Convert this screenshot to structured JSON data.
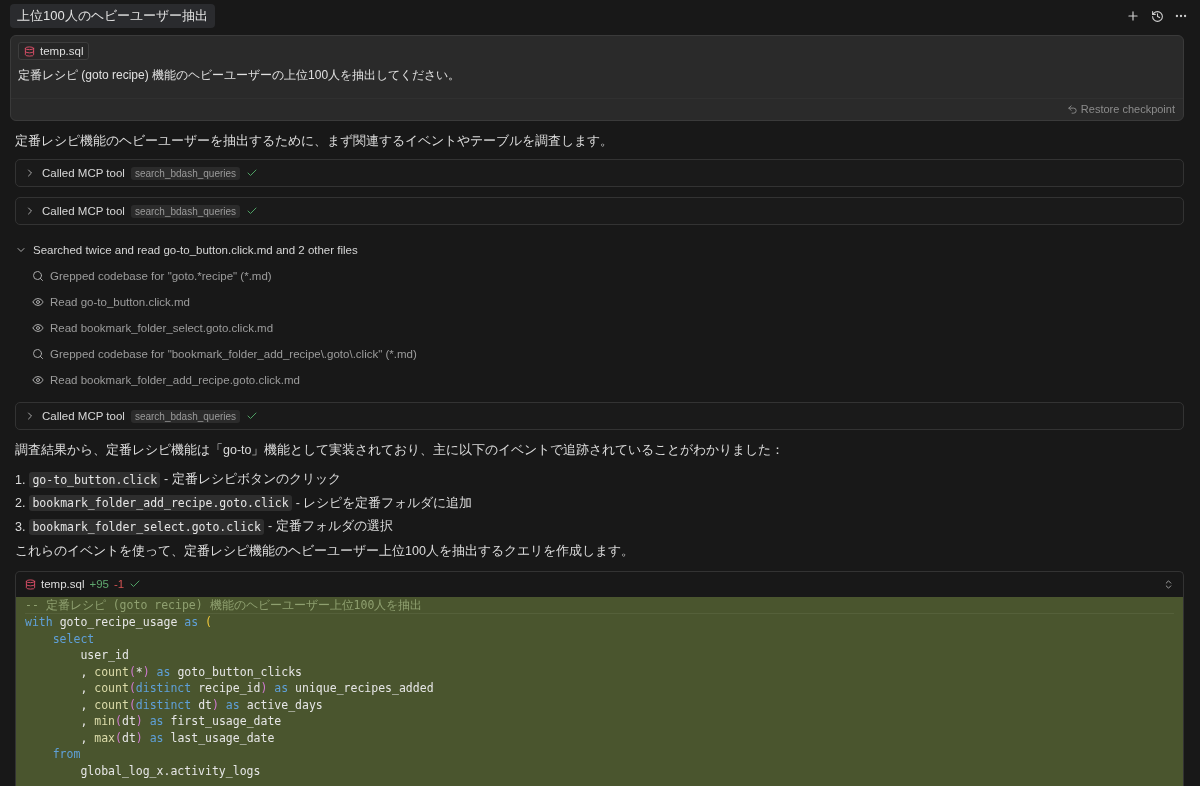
{
  "title": "上位100人のヘビーユーザー抽出",
  "user_message": {
    "attachment": "temp.sql",
    "text": "定番レシピ (goto recipe) 機能のヘビーユーザーの上位100人を抽出してください。",
    "restore": "Restore checkpoint"
  },
  "steps": [
    {
      "kind": "text",
      "text": "定番レシピ機能のヘビーユーザーを抽出するために、まず関連するイベントやテーブルを調査します。"
    },
    {
      "kind": "tool",
      "label": "Called MCP tool",
      "tool": "search_bdash_queries",
      "expanded": false,
      "done": true
    },
    {
      "kind": "tool",
      "label": "Called MCP tool",
      "tool": "search_bdash_queries",
      "expanded": false,
      "done": true
    },
    {
      "kind": "group",
      "label": "Searched twice and read go-to_button.click.md and 2 other files",
      "expanded": true,
      "children": [
        {
          "kind": "search",
          "text": "Grepped codebase for \"goto.*recipe\" (*.md)"
        },
        {
          "kind": "read",
          "text": "Read go-to_button.click.md"
        },
        {
          "kind": "read",
          "text": "Read bookmark_folder_select.goto.click.md"
        },
        {
          "kind": "search",
          "text": "Grepped codebase for \"bookmark_folder_add_recipe\\.goto\\.click\" (*.md)"
        },
        {
          "kind": "read",
          "text": "Read bookmark_folder_add_recipe.goto.click.md"
        }
      ]
    },
    {
      "kind": "tool",
      "label": "Called MCP tool",
      "tool": "search_bdash_queries",
      "expanded": false,
      "done": true
    },
    {
      "kind": "text",
      "text": "調査結果から、定番レシピ機能は「go-to」機能として実装されており、主に以下のイベントで追跡されていることがわかりました："
    },
    {
      "kind": "list",
      "items": [
        {
          "number": "1.",
          "code": "go-to_button.click",
          "text": "- 定番レシピボタンのクリック"
        },
        {
          "number": "2.",
          "code": "bookmark_folder_add_recipe.goto.click",
          "text": "- レシピを定番フォルダに追加"
        },
        {
          "number": "3.",
          "code": "bookmark_folder_select.goto.click",
          "text": "- 定番フォルダの選択"
        }
      ]
    },
    {
      "kind": "text",
      "text": "これらのイベントを使って、定番レシピ機能のヘビーユーザー上位100人を抽出するクエリを作成します。"
    },
    {
      "kind": "code",
      "file": "temp.sql",
      "added": "+95",
      "removed": "-1",
      "done": true,
      "lines": [
        [
          {
            "kind": "comment",
            "text": "-- 定番レシピ (goto recipe) 機能のヘビーユーザー上位100人を抽出"
          }
        ],
        [
          {
            "kind": "keyword",
            "text": "with"
          },
          {
            "kind": "plain",
            "text": " goto_recipe_usage "
          },
          {
            "kind": "keyword",
            "text": "as"
          },
          {
            "kind": "paren",
            "text": " ("
          }
        ],
        [
          {
            "kind": "keyword",
            "text": "    select"
          }
        ],
        [
          {
            "kind": "plain",
            "text": "        user_id"
          }
        ],
        [
          {
            "kind": "plain",
            "text": "        , "
          },
          {
            "kind": "function",
            "text": "count"
          },
          {
            "kind": "paren2",
            "text": "("
          },
          {
            "kind": "plain",
            "text": "*"
          },
          {
            "kind": "paren2",
            "text": ")"
          },
          {
            "kind": "keyword",
            "text": " as"
          },
          {
            "kind": "plain",
            "text": " goto_button_clicks"
          }
        ],
        [
          {
            "kind": "plain",
            "text": "        , "
          },
          {
            "kind": "function",
            "text": "count"
          },
          {
            "kind": "paren2",
            "text": "("
          },
          {
            "kind": "keyword",
            "text": "distinct"
          },
          {
            "kind": "plain",
            "text": " recipe_id"
          },
          {
            "kind": "paren2",
            "text": ")"
          },
          {
            "kind": "keyword",
            "text": " as"
          },
          {
            "kind": "plain",
            "text": " unique_recipes_added"
          }
        ],
        [
          {
            "kind": "plain",
            "text": "        , "
          },
          {
            "kind": "function",
            "text": "count"
          },
          {
            "kind": "paren2",
            "text": "("
          },
          {
            "kind": "keyword",
            "text": "distinct"
          },
          {
            "kind": "plain",
            "text": " dt"
          },
          {
            "kind": "paren2",
            "text": ")"
          },
          {
            "kind": "keyword",
            "text": " as"
          },
          {
            "kind": "plain",
            "text": " active_days"
          }
        ],
        [
          {
            "kind": "plain",
            "text": "        , "
          },
          {
            "kind": "function",
            "text": "min"
          },
          {
            "kind": "paren2",
            "text": "("
          },
          {
            "kind": "plain",
            "text": "dt"
          },
          {
            "kind": "paren2",
            "text": ")"
          },
          {
            "kind": "keyword",
            "text": " as"
          },
          {
            "kind": "plain",
            "text": " first_usage_date"
          }
        ],
        [
          {
            "kind": "plain",
            "text": "        , "
          },
          {
            "kind": "function",
            "text": "max"
          },
          {
            "kind": "paren2",
            "text": "("
          },
          {
            "kind": "plain",
            "text": "dt"
          },
          {
            "kind": "paren2",
            "text": ")"
          },
          {
            "kind": "keyword",
            "text": " as"
          },
          {
            "kind": "plain",
            "text": " last_usage_date"
          }
        ],
        [
          {
            "kind": "keyword",
            "text": "    from"
          }
        ],
        [
          {
            "kind": "plain",
            "text": "        global_log_x.activity_logs"
          }
        ]
      ]
    }
  ]
}
